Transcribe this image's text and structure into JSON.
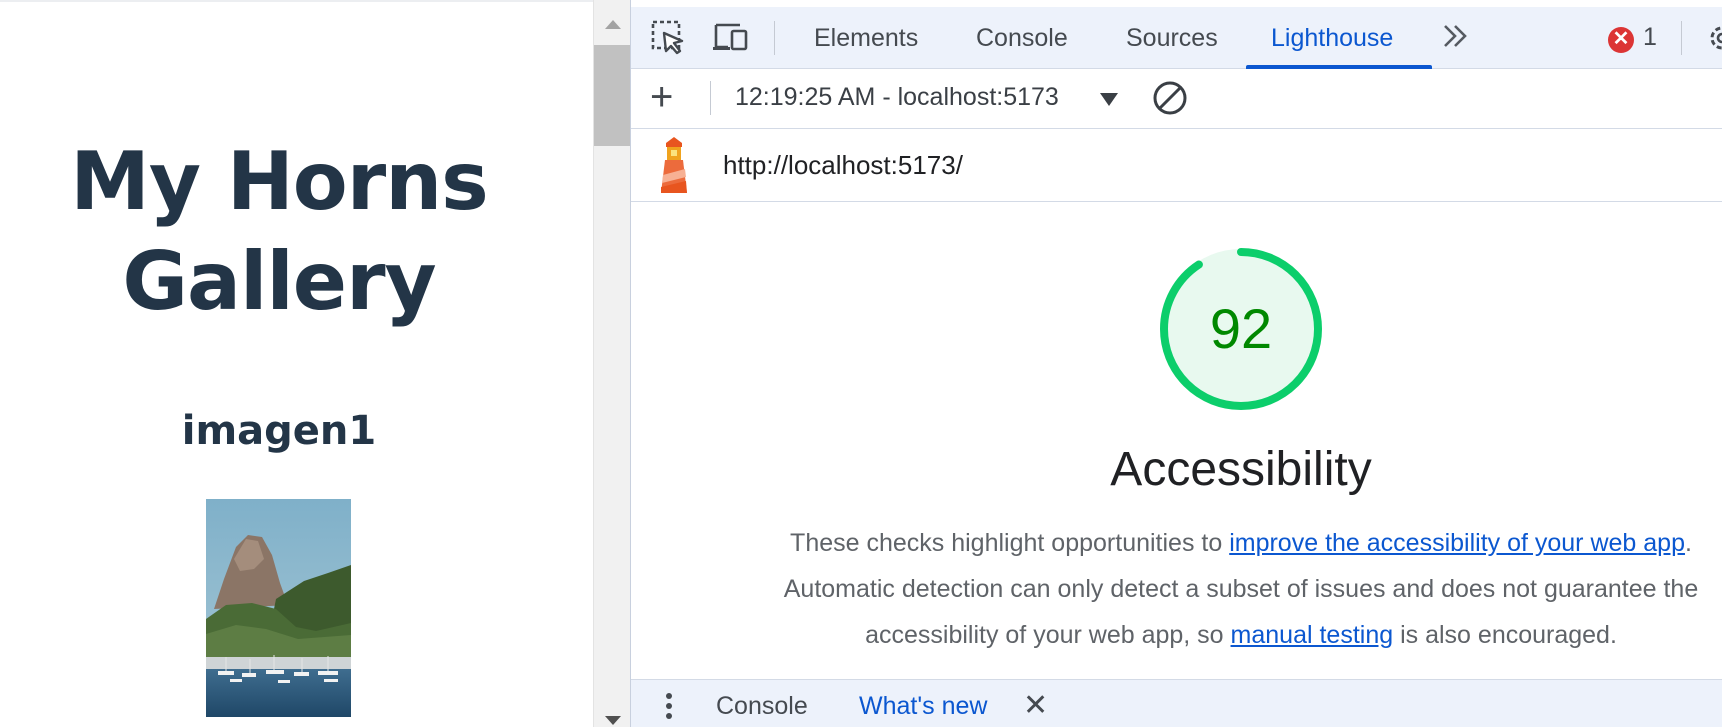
{
  "page": {
    "title_line1": "My Horns",
    "title_line2": "Gallery",
    "subtitle": "imagen1"
  },
  "devtools": {
    "tabs": [
      {
        "label": "Elements",
        "active": false
      },
      {
        "label": "Console",
        "active": false
      },
      {
        "label": "Sources",
        "active": false
      },
      {
        "label": "Lighthouse",
        "active": true
      }
    ],
    "more_tabs_label": "»",
    "error_count": "1",
    "error_badge_glyph": "✕",
    "report_selector": "12:19:25 AM - localhost:5173",
    "report_url": "http://localhost:5173/",
    "category": {
      "score": 92,
      "title": "Accessibility",
      "description_before": "These checks highlight opportunities to ",
      "link1": "improve the accessibility of your web app",
      "description_middle": ". Automatic detection can only detect a subset of issues and does not guarantee the accessibility of your web app, so ",
      "link2": "manual testing",
      "description_after": " is also encouraged."
    },
    "drawer": {
      "tabs": [
        {
          "label": "Console",
          "active": false
        },
        {
          "label": "What's new",
          "active": true
        }
      ],
      "close_glyph": "✕"
    }
  },
  "colors": {
    "heading": "#233547",
    "accent": "#0b57d0",
    "score_pass": "#0cce6b",
    "score_text": "#008800",
    "error": "#dc3535"
  },
  "icons": [
    "select-element-icon",
    "device-toolbar-icon",
    "chevrons-right-icon",
    "error-icon",
    "settings-icon",
    "plus-icon",
    "dropdown-arrow-icon",
    "clear-icon",
    "lighthouse-logo-icon",
    "kebab-menu-icon",
    "close-icon"
  ]
}
